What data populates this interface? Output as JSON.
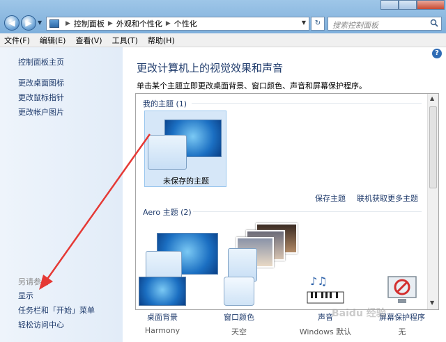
{
  "window": {
    "breadcrumbs": [
      "控制面板",
      "外观和个性化",
      "个性化"
    ],
    "search_placeholder": "搜索控制面板"
  },
  "menu": [
    "文件(F)",
    "编辑(E)",
    "查看(V)",
    "工具(T)",
    "帮助(H)"
  ],
  "sidebar": {
    "home": "控制面板主页",
    "tasks": [
      "更改桌面图标",
      "更改鼠标指针",
      "更改帐户图片"
    ],
    "see_also_title": "另请参阅",
    "see_also": [
      "显示",
      "任务栏和「开始」菜单",
      "轻松访问中心"
    ]
  },
  "main": {
    "heading": "更改计算机上的视觉效果和声音",
    "description": "单击某个主题立即更改桌面背景、窗口颜色、声音和屏幕保护程序。",
    "my_themes_label": "我的主题 (1)",
    "unsaved_theme": "未保存的主题",
    "save_theme": "保存主题",
    "get_more_themes": "联机获取更多主题",
    "aero_themes_label": "Aero 主题 (2)"
  },
  "bottom": [
    {
      "label": "桌面背景",
      "value": "Harmony",
      "icon": "desktop-background-icon"
    },
    {
      "label": "窗口颜色",
      "value": "天空",
      "icon": "window-color-icon"
    },
    {
      "label": "声音",
      "value": "Windows 默认",
      "icon": "sound-icon"
    },
    {
      "label": "屏幕保护程序",
      "value": "无",
      "icon": "screensaver-icon"
    }
  ],
  "colors": {
    "accent_link": "#1e3a6b",
    "arrow": "#e53935",
    "sidebar_bg": "#e8f0fa"
  },
  "watermark": "Baidu 经验"
}
